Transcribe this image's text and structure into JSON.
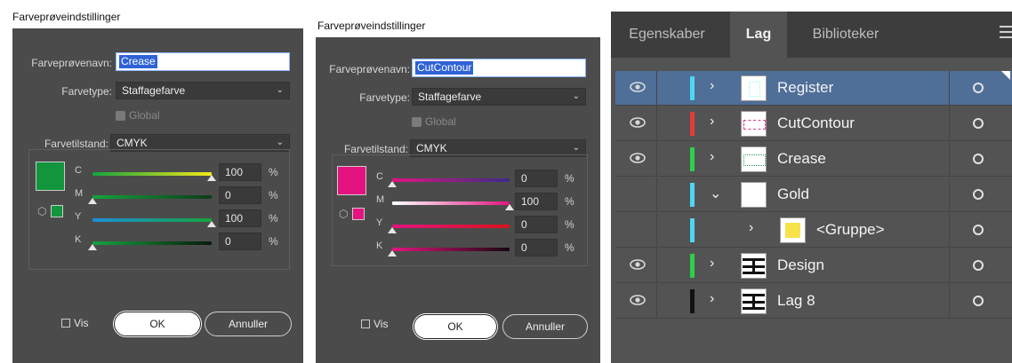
{
  "dialog1": {
    "title": "Farveprøveindstillinger",
    "name_label": "Farveprøvenavn:",
    "name_value": "Crease",
    "type_label": "Farvetype:",
    "type_value": "Staffagefarve",
    "global_label": "Global",
    "mode_label": "Farvetilstand:",
    "mode_value": "CMYK",
    "swatch_color": "#12953d",
    "sliders": [
      {
        "label": "C",
        "value": "100",
        "pct": "%",
        "level": 100,
        "gradient": "linear-gradient(to right,#14a43d,#f4e81a)"
      },
      {
        "label": "M",
        "value": "0",
        "pct": "%",
        "level": 0,
        "gradient": "linear-gradient(to right,#14a43d,#0f3b1a)"
      },
      {
        "label": "Y",
        "value": "100",
        "pct": "%",
        "level": 100,
        "gradient": "linear-gradient(to right,#1a8fd8,#14a43d)"
      },
      {
        "label": "K",
        "value": "0",
        "pct": "%",
        "level": 0,
        "gradient": "linear-gradient(to right,#14a43d,#0a1a0e)"
      }
    ],
    "vis_label": "Vis",
    "ok_label": "OK",
    "cancel_label": "Annuller"
  },
  "dialog2": {
    "title": "Farveprøveindstillinger",
    "name_label": "Farveprøvenavn:",
    "name_value": "CutContour",
    "type_label": "Farvetype:",
    "type_value": "Staffagefarve",
    "global_label": "Global",
    "mode_label": "Farvetilstand:",
    "mode_value": "CMYK",
    "swatch_color": "#e5137f",
    "sliders": [
      {
        "label": "C",
        "value": "0",
        "pct": "%",
        "level": 0,
        "gradient": "linear-gradient(to right,#e0157f,#3b2a8a)"
      },
      {
        "label": "M",
        "value": "100",
        "pct": "%",
        "level": 100,
        "gradient": "linear-gradient(to right,#ffffff,#e0157f)"
      },
      {
        "label": "Y",
        "value": "0",
        "pct": "%",
        "level": 0,
        "gradient": "linear-gradient(to right,#e0157f,#d8141c)"
      },
      {
        "label": "K",
        "value": "0",
        "pct": "%",
        "level": 0,
        "gradient": "linear-gradient(to right,#e0157f,#1a0610)"
      }
    ],
    "vis_label": "Vis",
    "ok_label": "OK",
    "cancel_label": "Annuller"
  },
  "layers_panel": {
    "tabs": [
      {
        "label": "Egenskaber",
        "active": false
      },
      {
        "label": "Lag",
        "active": true
      },
      {
        "label": "Biblioteker",
        "active": false
      }
    ],
    "layers": [
      {
        "name": "Register",
        "visible": true,
        "color": "#4fd6f0",
        "expanded": false,
        "indent": 0,
        "selected": true,
        "thumb": "register"
      },
      {
        "name": "CutContour",
        "visible": true,
        "color": "#e23b3b",
        "expanded": false,
        "indent": 0,
        "selected": false,
        "thumb": "cutcontour"
      },
      {
        "name": "Crease",
        "visible": true,
        "color": "#2ed14a",
        "expanded": false,
        "indent": 0,
        "selected": false,
        "thumb": "crease"
      },
      {
        "name": "Gold",
        "visible": false,
        "color": "#4fd6f0",
        "expanded": true,
        "indent": 0,
        "selected": false,
        "thumb": "blank"
      },
      {
        "name": "<Gruppe>",
        "visible": false,
        "color": "#4fd6f0",
        "expanded": false,
        "indent": 1,
        "selected": false,
        "thumb": "gold"
      },
      {
        "name": "Design",
        "visible": true,
        "color": "#2ed14a",
        "expanded": false,
        "indent": 0,
        "selected": false,
        "thumb": "design"
      },
      {
        "name": "Lag 8",
        "visible": true,
        "color": "#111111",
        "expanded": false,
        "indent": 0,
        "selected": false,
        "thumb": "design"
      }
    ]
  }
}
